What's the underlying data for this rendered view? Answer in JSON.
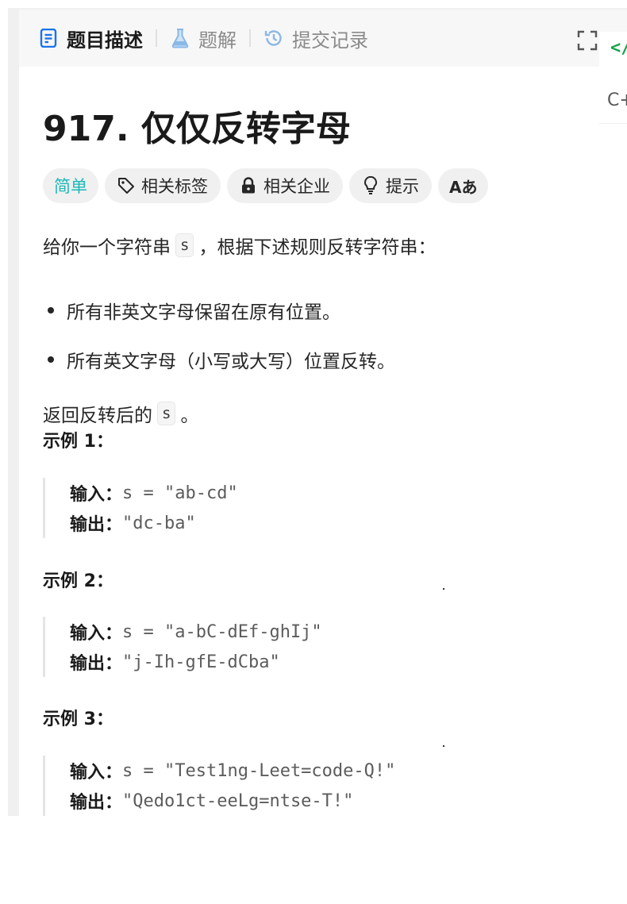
{
  "tabs": [
    {
      "label": "题目描述",
      "icon": "document-icon",
      "active": true
    },
    {
      "label": "题解",
      "icon": "flask-icon",
      "active": false
    },
    {
      "label": "提交记录",
      "icon": "history-icon",
      "active": false
    }
  ],
  "side": {
    "code_icon": "</",
    "language": "C+"
  },
  "problem": {
    "title": "917. 仅仅反转字母",
    "tags": {
      "difficulty": "简单",
      "related_tags": "相关标签",
      "related_companies": "相关企业",
      "hint": "提示",
      "translate": "Aあ"
    },
    "description": {
      "intro_before": "给你一个字符串",
      "intro_code": "s",
      "intro_after": "，根据下述规则反转字符串：",
      "rules": [
        "所有非英文字母保留在原有位置。",
        "所有英文字母（小写或大写）位置反转。"
      ],
      "return_before": "返回反转后的",
      "return_code": "s",
      "return_after": "。"
    },
    "examples": [
      {
        "heading": "示例 1：",
        "input_label": "输入：",
        "input": "s = \"ab-cd\"",
        "output_label": "输出：",
        "output": "\"dc-ba\""
      },
      {
        "heading": "示例 2：",
        "input_label": "输入：",
        "input": "s = \"a-bC-dEf-ghIj\"",
        "output_label": "输出：",
        "output": "\"j-Ih-gfE-dCba\""
      },
      {
        "heading": "示例 3：",
        "input_label": "输入：",
        "input": "s = \"Test1ng-Leet=code-Q!\"",
        "output_label": "输出：",
        "output": "\"Qedo1ct-eeLg=ntse-T!\""
      }
    ]
  },
  "colors": {
    "easy": "#1cb8b8",
    "accent_blue": "#1a73e8",
    "code_green": "#16a34a"
  }
}
